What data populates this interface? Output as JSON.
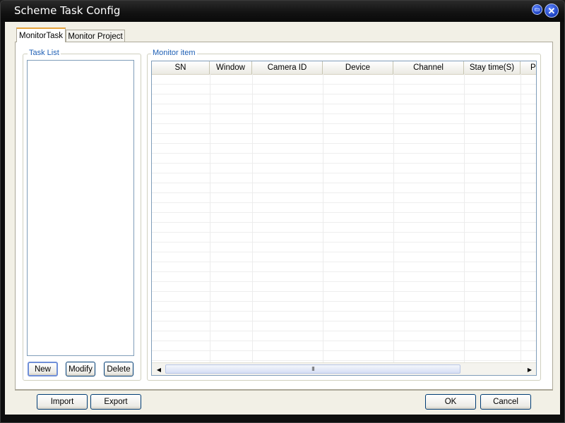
{
  "window": {
    "title": "Scheme Task Config",
    "controls": {
      "restore_icon": "restore-icon",
      "close_icon": "close-icon"
    }
  },
  "tabs": [
    {
      "label": "MonitorTask",
      "active": true
    },
    {
      "label": "Monitor Project",
      "active": false
    }
  ],
  "task_list": {
    "label": "Task List",
    "items": [],
    "buttons": {
      "new": "New",
      "modify": "Modify",
      "delete": "Delete"
    }
  },
  "monitor_item": {
    "label": "Monitor item",
    "columns": [
      "SN",
      "Window",
      "Camera ID",
      "Device",
      "Channel",
      "Stay time(S)",
      "P"
    ],
    "rows": [],
    "scrollbar": {
      "grip": "III"
    }
  },
  "footer": {
    "import": "Import",
    "export": "Export",
    "ok": "OK",
    "cancel": "Cancel"
  },
  "colors": {
    "titlebar": "#111111",
    "client_bg": "#f2f0e6",
    "group_label": "#1e5fb4",
    "tab_accent": "#e6a33a"
  }
}
